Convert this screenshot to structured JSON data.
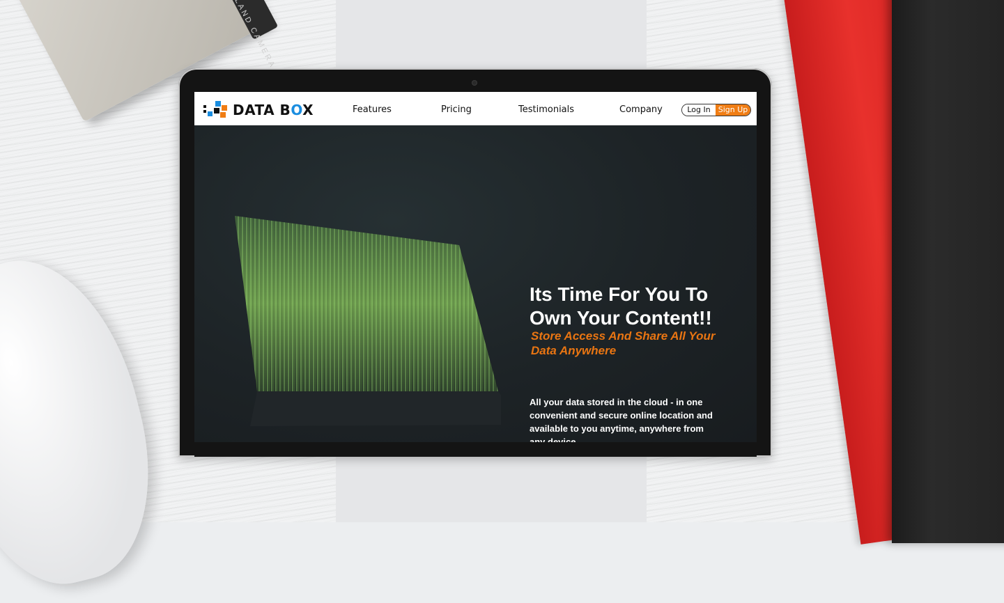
{
  "brand": {
    "name_part1": "DATA B",
    "name_o": "O",
    "name_part2": "X",
    "colors": {
      "orange": "#f07d14",
      "blue": "#1a8de0",
      "dark": "#111111"
    }
  },
  "nav": {
    "links": [
      "Features",
      "Pricing",
      "Testimonials",
      "Company"
    ],
    "login_label": "Log In",
    "signup_label": "Sign Up"
  },
  "hero": {
    "title": "Its Time For You To Own Your Content!!",
    "subtitle": "Store Access And Share All Your Data Anywhere",
    "body": "All your data stored in the cloud - in one convenient and secure online location and available to you anytime, anywhere from any device.",
    "image": "laptop-matrix-code-image"
  },
  "scene": {
    "camera_label": "POLAROID LAND CAMERA"
  },
  "colors": {
    "hero_bg": "#1e2326",
    "accent": "#e97512"
  }
}
